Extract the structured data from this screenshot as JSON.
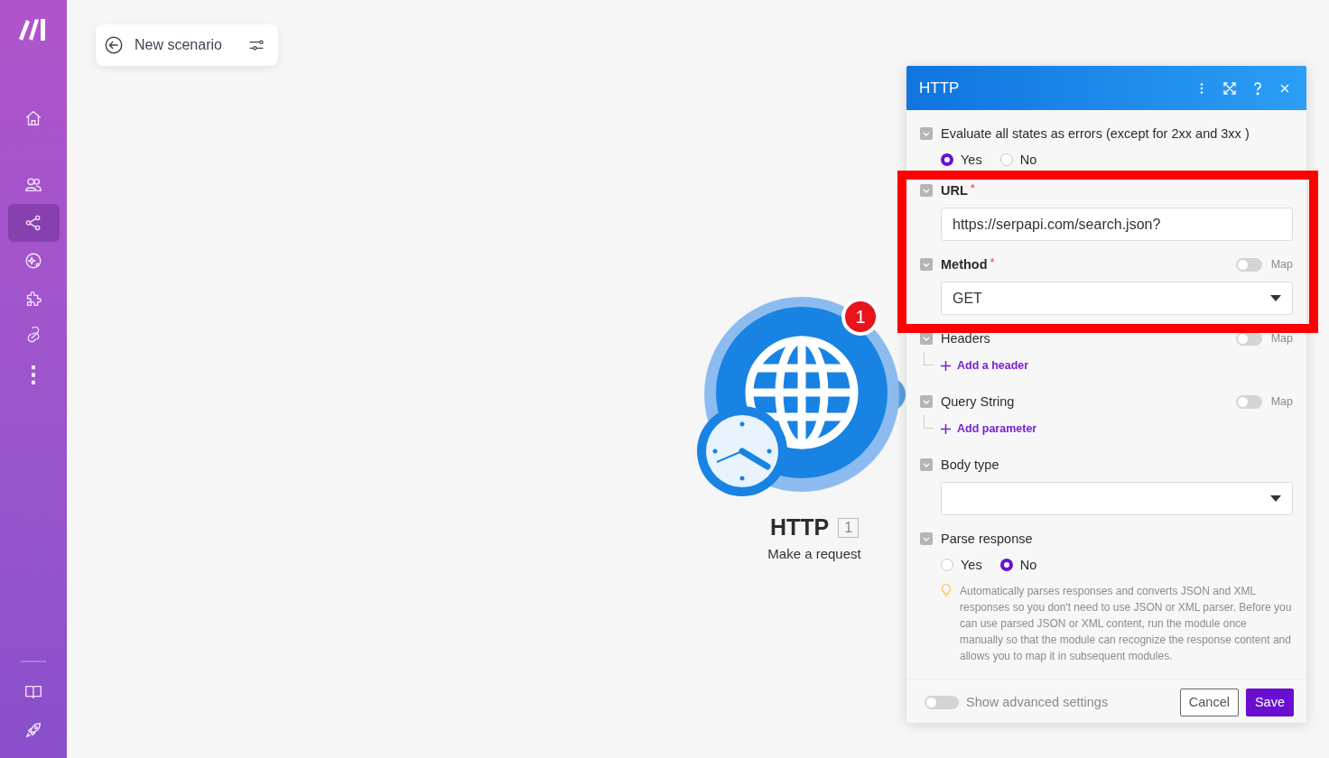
{
  "sidebar": {
    "items": [
      {
        "kind": "home",
        "selected": false
      },
      {
        "kind": "team",
        "selected": false
      },
      {
        "kind": "share",
        "selected": true
      },
      {
        "kind": "sparkle",
        "selected": false
      },
      {
        "kind": "puzzle",
        "selected": false
      },
      {
        "kind": "link",
        "selected": false
      },
      {
        "kind": "more",
        "selected": false
      }
    ],
    "bottom": [
      {
        "kind": "book",
        "selected": false
      },
      {
        "kind": "rocket",
        "selected": false
      }
    ]
  },
  "scenario": {
    "title": "New scenario"
  },
  "node": {
    "title": "HTTP",
    "number": "1",
    "subtitle": "Make a request",
    "badge": "1"
  },
  "panel": {
    "title": "HTTP",
    "fields": [
      {
        "kind": "radio",
        "label": "Evaluate all states as errors (except for 2xx and 3xx )",
        "options": [
          {
            "label": "Yes",
            "selected": true
          },
          {
            "label": "No",
            "selected": false
          }
        ]
      },
      {
        "kind": "text",
        "label": "URL",
        "required": "*",
        "value": "https://serpapi.com/search.json?"
      },
      {
        "kind": "select",
        "label": "Method",
        "required": "*",
        "map": {
          "label": "Map",
          "on": false
        },
        "value": "GET"
      },
      {
        "kind": "list",
        "label": "Headers",
        "map": {
          "label": "Map",
          "on": false
        },
        "add": "Add a header"
      },
      {
        "kind": "list",
        "label": "Query String",
        "map": {
          "label": "Map",
          "on": false
        },
        "add": "Add parameter"
      },
      {
        "kind": "select",
        "label": "Body type"
      },
      {
        "kind": "radio",
        "label": "Parse response",
        "options": [
          {
            "label": "Yes",
            "selected": false
          },
          {
            "label": "No",
            "selected": true
          }
        ],
        "hint": "Automatically parses responses and converts JSON and XML responses so you don't need to use JSON or XML parser. Before you can use parsed JSON or XML content, run the module once manually so that the module can recognize the response content and allows you to map it in subsequent modules."
      }
    ],
    "footer": {
      "advanced": {
        "label": "Show advanced settings",
        "on": false
      },
      "buttons": [
        {
          "label": "Cancel",
          "kind": "secondary"
        },
        {
          "label": "Save",
          "kind": "primary"
        }
      ]
    }
  }
}
